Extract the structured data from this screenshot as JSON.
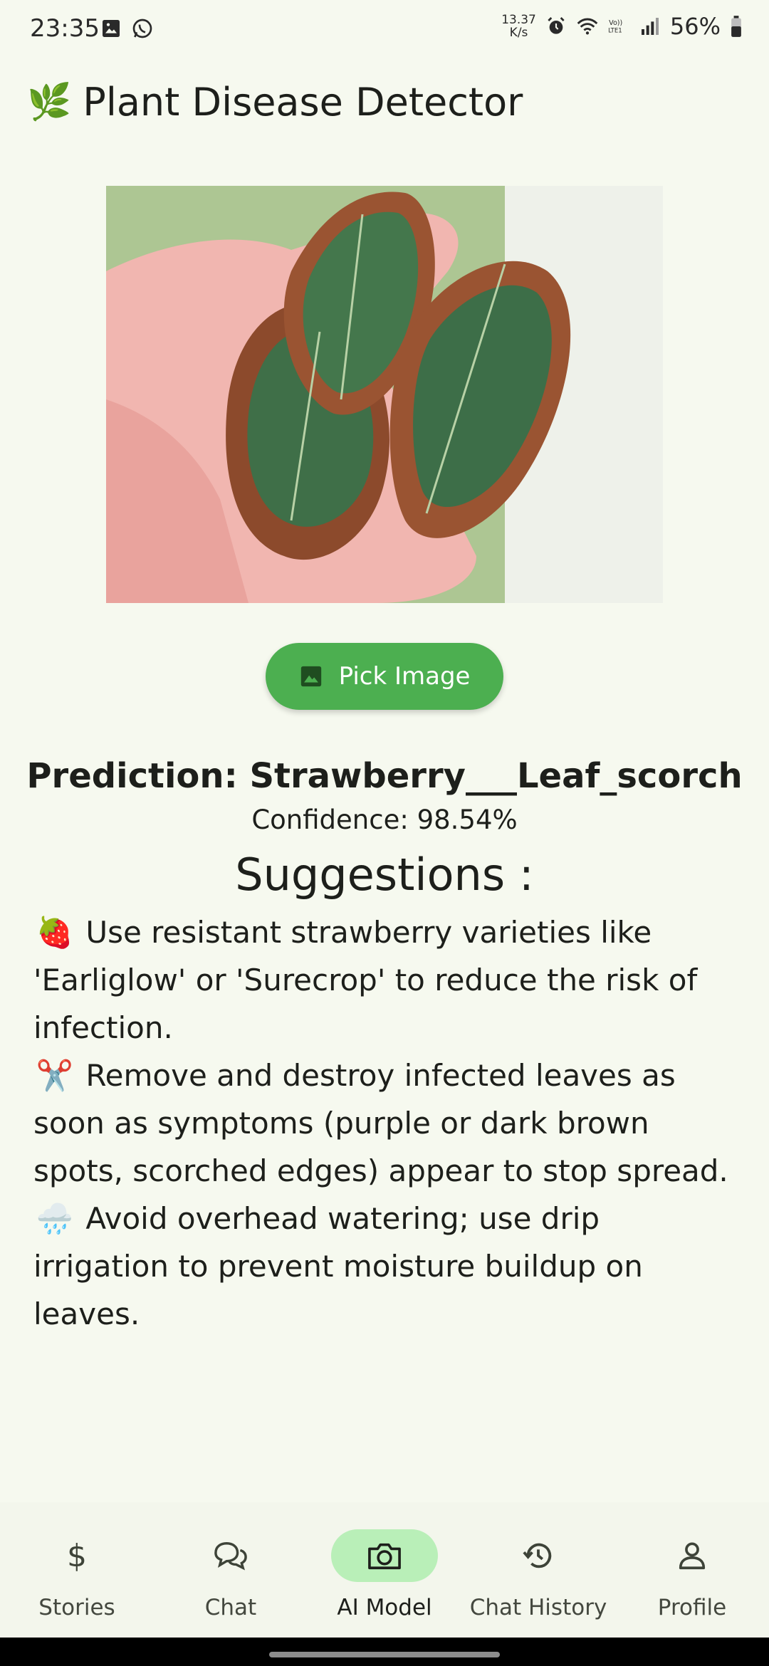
{
  "status_bar": {
    "time": "23:35",
    "net_speed_value": "13.37",
    "net_speed_unit": "K/s",
    "battery": "56%"
  },
  "app_bar": {
    "title": "Plant Disease Detector",
    "leaf_emoji": "🌿"
  },
  "image": {
    "icon": "leaf-photo"
  },
  "pick_button": {
    "label": "Pick Image",
    "icon": "image-icon"
  },
  "result": {
    "prediction": "Prediction: Strawberry___Leaf_scorch",
    "confidence": "Confidence: 98.54%"
  },
  "suggestions": {
    "title": "Suggestions :",
    "items": [
      {
        "emoji": "🍓",
        "text": "Use resistant strawberry varieties like 'Earliglow' or 'Surecrop' to reduce the risk of infection."
      },
      {
        "emoji": "✂️",
        "text": "Remove and destroy infected leaves as soon as symptoms (purple or dark brown spots, scorched edges) appear to stop spread."
      },
      {
        "emoji": "🌧️",
        "text": "Avoid overhead watering; use drip irrigation to prevent moisture buildup on leaves."
      }
    ]
  },
  "bottom_nav": {
    "items": [
      {
        "label": "Stories",
        "icon": "dollar-icon",
        "glyph": "$"
      },
      {
        "label": "Chat",
        "icon": "chat-icon"
      },
      {
        "label": "AI Model",
        "icon": "camera-icon",
        "active": true
      },
      {
        "label": "Chat History",
        "icon": "history-icon"
      },
      {
        "label": "Profile",
        "icon": "person-icon"
      }
    ]
  },
  "colors": {
    "background": "#f6f9ef",
    "accent": "#4caf50",
    "nav_active": "#b9efb8"
  }
}
